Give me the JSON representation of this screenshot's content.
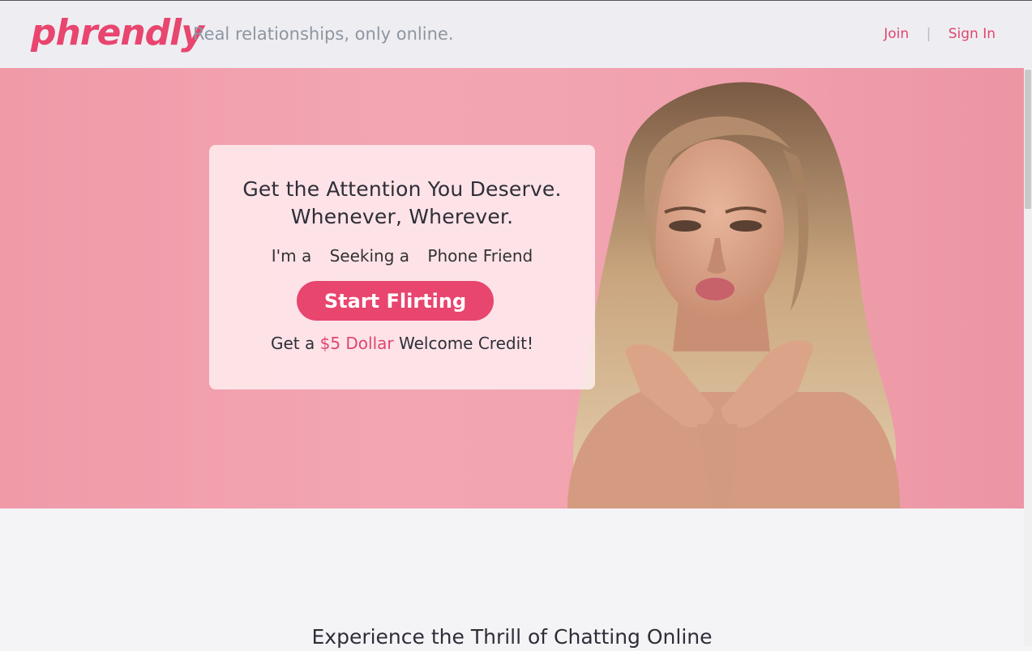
{
  "brand": {
    "logo_text": "phrendly",
    "tagline": "Real relationships, only online."
  },
  "nav": {
    "join": "Join",
    "separator": "|",
    "sign_in": "Sign In"
  },
  "hero": {
    "headline_line1": "Get the Attention You Deserve.",
    "headline_line2": "Whenever, Wherever.",
    "seeking": {
      "im_a": "I'm a",
      "seeking_a": "Seeking a",
      "phone_friend": "Phone Friend"
    },
    "cta_label": "Start Flirting",
    "credit": {
      "prefix": "Get a",
      "amount": "$5 Dollar",
      "suffix": "Welcome Credit!"
    },
    "image_alt": "woman blowing a kiss"
  },
  "section": {
    "title": "Experience the Thrill of Chatting Online"
  },
  "colors": {
    "accent": "#e8456f",
    "hero_bg": "#f3a6b2",
    "page_bg": "#f4f4f7",
    "header_bg": "#eeeef2"
  }
}
